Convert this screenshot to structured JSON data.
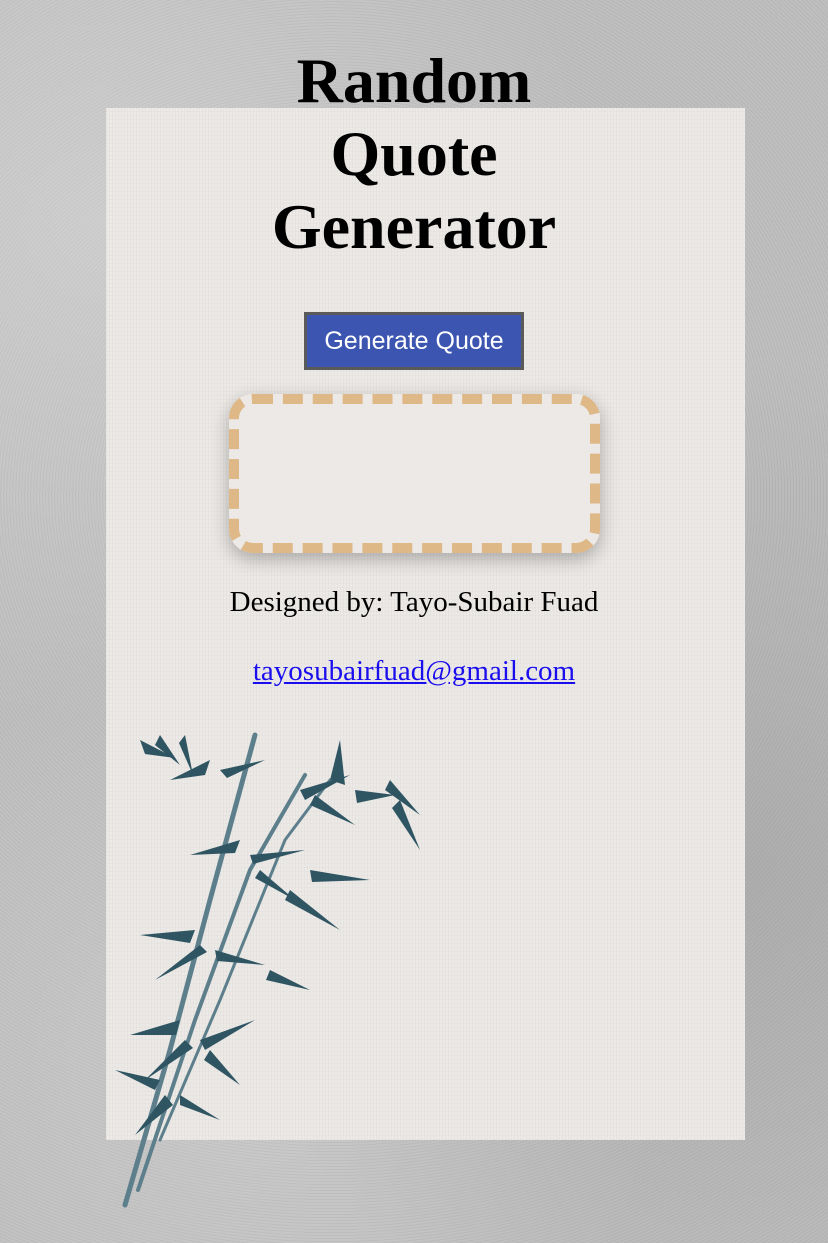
{
  "header": {
    "title_lines": [
      "Random",
      "Quote",
      "Generator"
    ]
  },
  "actions": {
    "generate_label": "Generate Quote"
  },
  "quote": {
    "text": ""
  },
  "footer": {
    "credits": "Designed by: Tayo-Subair Fuad",
    "email": "tayosubairfuad@gmail.com"
  },
  "colors": {
    "button": "#3b55b0",
    "quote_border": "#deb887",
    "link": "#1a0dee"
  },
  "decoration": {
    "bamboo_icon": "bamboo-illustration"
  }
}
